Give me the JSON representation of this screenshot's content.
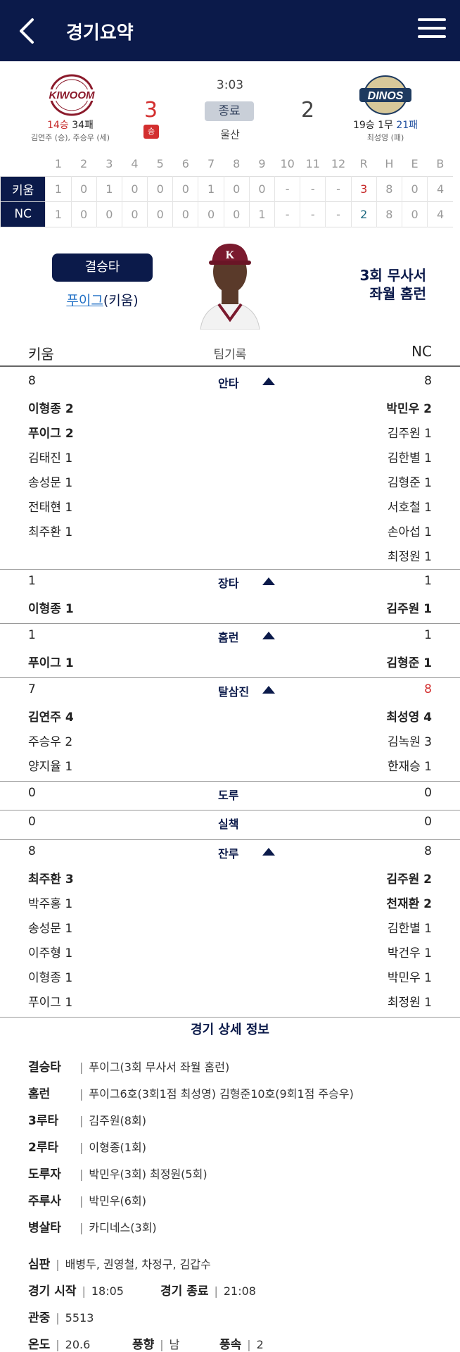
{
  "header": {
    "title": "경기요약"
  },
  "game": {
    "time": "3:03",
    "status": "종료",
    "stadium": "울산",
    "home": {
      "wins": "14승",
      "losses": "34패",
      "pitchers": "김연주 (승), 주승우 (세)",
      "score": "3",
      "win_badge": "승"
    },
    "away": {
      "record_prefix": "19승 1무",
      "losses": "21패",
      "pitchers": "최성영 (패)",
      "score": "2"
    }
  },
  "linescore": {
    "headers": [
      "",
      "1",
      "2",
      "3",
      "4",
      "5",
      "6",
      "7",
      "8",
      "9",
      "10",
      "11",
      "12",
      "R",
      "H",
      "E",
      "B"
    ],
    "rows": [
      {
        "team": "키움",
        "cells": [
          "1",
          "0",
          "1",
          "0",
          "0",
          "0",
          "1",
          "0",
          "0",
          "-",
          "-",
          "-",
          "3",
          "8",
          "0",
          "4"
        ]
      },
      {
        "team": "NC",
        "cells": [
          "1",
          "0",
          "0",
          "0",
          "0",
          "0",
          "0",
          "0",
          "1",
          "-",
          "-",
          "-",
          "2",
          "8",
          "0",
          "4"
        ]
      }
    ]
  },
  "winhit": {
    "badge": "결승타",
    "player_name": "푸이그",
    "player_team": "(키움)",
    "desc1": "3회 무사서",
    "desc2": "좌월 홈런"
  },
  "team_records": {
    "home_label": "키움",
    "center_label": "팀기록",
    "away_label": "NC",
    "sections": [
      {
        "title": "안타",
        "home_total": "8",
        "away_total": "8",
        "expand": true,
        "rows": [
          [
            "이형종 2",
            "박민우 2"
          ],
          [
            "푸이그 2",
            "김주원 1"
          ],
          [
            "김태진 1",
            "김한별 1"
          ],
          [
            "송성문 1",
            "김형준 1"
          ],
          [
            "전태현 1",
            "서호철 1"
          ],
          [
            "최주환 1",
            "손아섭 1"
          ],
          [
            "",
            "최정원 1"
          ]
        ]
      },
      {
        "title": "장타",
        "home_total": "1",
        "away_total": "1",
        "expand": true,
        "rows": [
          [
            "이형종 1",
            "김주원 1"
          ]
        ]
      },
      {
        "title": "홈런",
        "home_total": "1",
        "away_total": "1",
        "expand": true,
        "rows": [
          [
            "푸이그 1",
            "김형준 1"
          ]
        ]
      },
      {
        "title": "탈삼진",
        "home_total": "7",
        "away_total": "8",
        "expand": true,
        "rows": [
          [
            "김연주 4",
            "최성영 4"
          ],
          [
            "주승우 2",
            "김녹원 3"
          ],
          [
            "양지율 1",
            "한재승 1"
          ]
        ]
      },
      {
        "title": "도루",
        "home_total": "0",
        "away_total": "0",
        "expand": false,
        "rows": []
      },
      {
        "title": "실책",
        "home_total": "0",
        "away_total": "0",
        "expand": false,
        "rows": []
      },
      {
        "title": "잔루",
        "home_total": "8",
        "away_total": "8",
        "expand": true,
        "rows": [
          [
            "최주환 3",
            "김주원 2"
          ],
          [
            "박주홍 1",
            "천재환 2"
          ],
          [
            "송성문 1",
            "김한별 1"
          ],
          [
            "이주형 1",
            "박건우 1"
          ],
          [
            "이형종 1",
            "박민우 1"
          ],
          [
            "푸이그 1",
            "최정원 1"
          ]
        ]
      }
    ]
  },
  "details": {
    "title": "경기 상세 정보",
    "items": [
      {
        "key": "결승타",
        "value": "푸이그(3회 무사서 좌월 홈런)"
      },
      {
        "key": "홈런",
        "value": "푸이그6호(3회1점 최성영) 김형준10호(9회1점 주승우)"
      },
      {
        "key": "3루타",
        "value": "김주원(8회)"
      },
      {
        "key": "2루타",
        "value": "이형종(1회)"
      },
      {
        "key": "도루자",
        "value": "박민우(3회) 최정원(5회)"
      },
      {
        "key": "주루사",
        "value": "박민우(6회)"
      },
      {
        "key": "병살타",
        "value": "카디네스(3회)"
      }
    ],
    "umpire_label": "심판",
    "umpire": "배병두, 권영철, 차정구, 김갑수",
    "start_label": "경기 시작",
    "start": "18:05",
    "end_label": "경기 종료",
    "end": "21:08",
    "crowd_label": "관중",
    "crowd": "5513",
    "temp_label": "온도",
    "temp": "20.6",
    "wind_dir_label": "풍향",
    "wind_dir": "남",
    "wind_speed_label": "풍속",
    "wind_speed": "2"
  },
  "colors": {
    "navy": "#0b1a4a",
    "red": "#d32f2f",
    "blue": "#1f4e9e"
  },
  "icons": {
    "back": "chevron-left-icon",
    "menu": "hamburger-menu-icon",
    "expand": "triangle-up-icon"
  }
}
